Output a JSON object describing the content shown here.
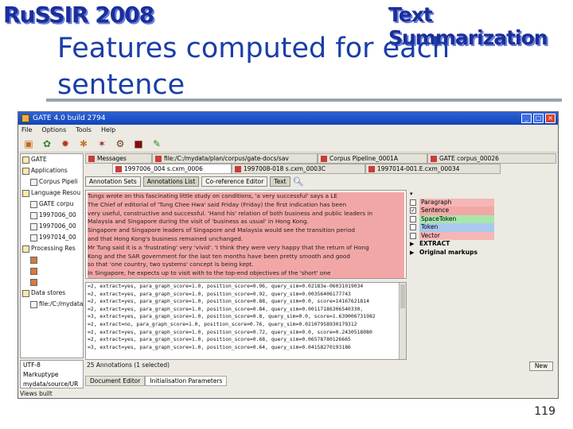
{
  "header": {
    "banner_left": "RuSSIR 2008",
    "banner_right": "Text Summarization",
    "title_line1": "Features computed for each",
    "title_line2": "sentence",
    "page_number": "119"
  },
  "window": {
    "title": "GATE 4.0 build 2794",
    "menu": [
      "File",
      "Options",
      "Tools",
      "Help"
    ],
    "toolbar_icons": [
      "open-application-icon",
      "new-resource-icon",
      "new-pr-icon",
      "create-datastore-icon",
      "run-icon",
      "stop-icon",
      "save-icon",
      "paint-icon"
    ]
  },
  "tree": {
    "items": [
      {
        "label": "GATE",
        "indent": 0,
        "kind": "folder"
      },
      {
        "label": "Applications",
        "indent": 0,
        "kind": "folder"
      },
      {
        "label": "Corpus Pipeli",
        "indent": 1,
        "kind": "doc"
      },
      {
        "label": "Language Resou",
        "indent": 0,
        "kind": "folder"
      },
      {
        "label": "GATE corpu",
        "indent": 1,
        "kind": "doc"
      },
      {
        "label": "1997006_00",
        "indent": 1,
        "kind": "doc"
      },
      {
        "label": "1997006_00",
        "indent": 1,
        "kind": "doc"
      },
      {
        "label": "1997014_00",
        "indent": 1,
        "kind": "doc"
      },
      {
        "label": "Processing Res",
        "indent": 0,
        "kind": "folder"
      },
      {
        "label": "",
        "indent": 1,
        "kind": "pr"
      },
      {
        "label": "",
        "indent": 1,
        "kind": "pr"
      },
      {
        "label": "",
        "indent": 1,
        "kind": "pr"
      },
      {
        "label": "Data stores",
        "indent": 0,
        "kind": "folder"
      },
      {
        "label": "file:/C:/mydatal",
        "indent": 1,
        "kind": "doc"
      }
    ],
    "lower_panel": [
      "UTF-8",
      "Markuptype",
      "mydata/source/UR"
    ],
    "status": "Views built"
  },
  "main": {
    "tabs_row1": [
      {
        "label": "Messages",
        "active": false
      },
      {
        "label": "file:/C:/mydata/plan/corpus/gate-docs/sav",
        "active": false
      },
      {
        "label": "Corpus Pipeline_0001A",
        "active": false
      },
      {
        "label": "GATE corpus_00026",
        "active": false
      }
    ],
    "tabs_row2": [
      {
        "label": "1997006_004 s.cxm_0006",
        "active": true
      },
      {
        "label": "1997008-018 s.cxm_0003C",
        "active": false
      },
      {
        "label": "1997014-001.E.cxm_00034",
        "active": false
      }
    ],
    "subtools": [
      "Annotation Sets",
      "Annotations List",
      "Co-reference Editor",
      "Text"
    ],
    "text_lines": [
      {
        "text": "Tungs wrote on this fascinating little study on conditions, 'a very successful' says a LE",
        "hl": true
      },
      {
        "text": "The Chief of editorial of 'Tung Chee Hwa' said Friday (Friday) the first indication has been",
        "hl": true
      },
      {
        "text": "very useful, constructive and successful. 'Hand his' relation of both business and public leaders in",
        "hl": true
      },
      {
        "text": "Malaysia and Singapore during the visit of 'business as usual' in Hong Kong.",
        "hl": true
      },
      {
        "text": "Singapore and Singapore leaders of Singapore and Malaysia would see the transition period",
        "hl": true
      },
      {
        "text": "and that Hong Kong's business remained unchanged.",
        "hl": true
      },
      {
        "text": "Mr Tung said it is a 'frustrating' very 'vivid'. 'I think they were very happy that the return of Hong",
        "hl": true
      },
      {
        "text": "Kong and the SAR government for the last ten months have been pretty smooth and good",
        "hl": true
      },
      {
        "text": "so that 'one country, two systems' concept is being kept.",
        "hl": true
      },
      {
        "text": "In Singapore, he expects up to visit with to the top-end objectives of the 'short' one",
        "hl": true
      }
    ],
    "types": [
      {
        "label": "",
        "checked": false,
        "color": "",
        "arrow": "▾"
      },
      {
        "label": "Paragraph",
        "checked": false,
        "color": "#f6b6b6",
        "arrow": ""
      },
      {
        "label": "Sentence",
        "checked": true,
        "color": "#f2a7a7",
        "arrow": ""
      },
      {
        "label": "SpaceToken",
        "checked": false,
        "color": "#a9e6a9",
        "arrow": ""
      },
      {
        "label": "Token",
        "checked": false,
        "color": "#a9c8f0",
        "arrow": ""
      },
      {
        "label": "Vector",
        "checked": false,
        "color": "#f6b6b6",
        "arrow": ""
      },
      {
        "label": "EXTRACT",
        "checked": false,
        "color": "",
        "arrow": "▶"
      },
      {
        "label": "Original markups",
        "checked": false,
        "color": "",
        "arrow": "▶"
      }
    ],
    "annotation_rows": [
      "=2, extract=yes, para_graph_score=1.0, position_score=0.96, query_sim=0.02183e-06031019034",
      "=2, extract=yes, para_graph_score=1.0, position_score=0.92, query_sim=0.00356406177743",
      "=2, extract=yes, para_graph_score=1.0, position_score=0.88, query_sim=0.0, score=14167621814",
      "=2, extract=yes, para_graph_score=1.0, position_score=0.84, query_sim=0.00117186306540330,",
      "=3, extract=yes, para_graph_score=1.0, position_score=0.8, query_sim=0.0, score=1.639006731982",
      "=2, extract=no, para_graph_score=1.0, position_score=0.76, query_sim=0.02107958930179312",
      "=2, extract=yes, para_graph_score=1.0, position_score=0.72, query_sim=0.0, score=0.2430518080",
      "=2, extract=yes, para_graph_score=1.0, position_score=0.68, query_sim=0.06578780126665",
      "=3, extract=yes, para_graph_score=1.0, position_score=0.64, query_sim=0.04158270193186"
    ],
    "annotation_count": "25 Annotations (1 selected)",
    "new_button": "New",
    "bottom_tabs": [
      {
        "label": "Document Editor",
        "active": false
      },
      {
        "label": "Initialisation Parameters",
        "active": true
      }
    ]
  }
}
